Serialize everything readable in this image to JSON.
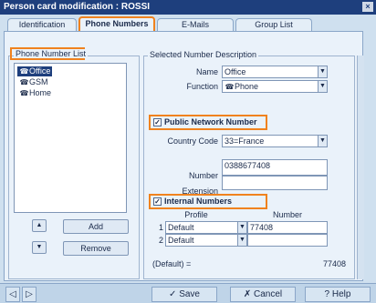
{
  "window": {
    "title": "Person card modification : ROSSI",
    "close": "×"
  },
  "tabs": [
    {
      "label": "Identification"
    },
    {
      "label": "Phone Numbers"
    },
    {
      "label": "E-Mails"
    },
    {
      "label": "Group List"
    }
  ],
  "phone_list": {
    "title": "Phone Number List",
    "items": [
      {
        "label": "Office"
      },
      {
        "label": "GSM"
      },
      {
        "label": "Home"
      }
    ],
    "add_label": "Add",
    "remove_label": "Remove",
    "up_arrow": "▲",
    "down_arrow": "▼"
  },
  "description": {
    "title": "Selected Number Description",
    "name_label": "Name",
    "name_value": "Office",
    "function_label": "Function",
    "function_value": "Phone"
  },
  "public_network": {
    "checkbox_label": "Public Network Number",
    "checked": true,
    "country_code_label": "Country Code",
    "country_code_value": "33=France",
    "number_label": "Number",
    "number_value": "0388677408",
    "extension_label": "Extension",
    "extension_value": ""
  },
  "internal": {
    "checkbox_label": "Internal Numbers",
    "checked": true,
    "profile_header": "Profile",
    "number_header": "Number",
    "rows": [
      {
        "index": "1",
        "profile": "Default",
        "number": "77408"
      },
      {
        "index": "2",
        "profile": "Default",
        "number": ""
      }
    ],
    "default_label": "(Default) =",
    "default_value": "77408"
  },
  "bottom": {
    "save_label": "Save",
    "cancel_label": "Cancel",
    "help_label": "Help"
  },
  "colors": {
    "accent": "#f0821e",
    "title_bg": "#1e3f7d",
    "panel_bg": "#eaf2fa"
  }
}
